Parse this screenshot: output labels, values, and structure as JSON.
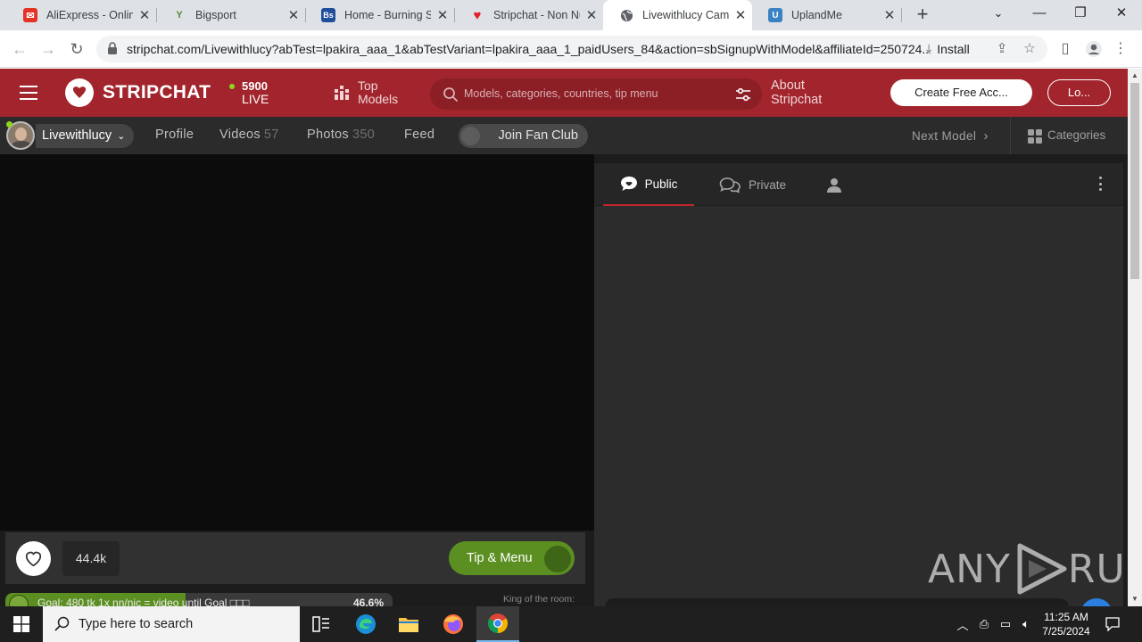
{
  "browser": {
    "tabs": [
      {
        "title": "AliExpress - Online",
        "icon": "aliexpress-icon",
        "color": "#e43225"
      },
      {
        "title": "Bigsport",
        "icon": "bigsport-icon",
        "color": "#5b8a3c"
      },
      {
        "title": "Home - Burning S",
        "icon": "bs-icon",
        "color": "#1f4e9a"
      },
      {
        "title": "Stripchat - Non Nu",
        "icon": "heart-icon",
        "color": "#e0202a"
      },
      {
        "title": "Livewithlucy Cam",
        "icon": "globe-icon",
        "color": "#5f6368"
      },
      {
        "title": "UplandMe",
        "icon": "uplandme-icon",
        "color": "#3b82c4"
      }
    ],
    "active_tab": 4,
    "url": "stripchat.com/Livewithlucy?abTest=lpakira_aaa_1&abTestVariant=lpakira_aaa_1_paidUsers_84&action=sbSignupWithModel&affiliateId=250724...",
    "install_label": "Install"
  },
  "header": {
    "brand": "STRIPCHAT",
    "live_count": "5900",
    "live_label": "LIVE",
    "top_models_line1": "Top",
    "top_models_line2": "Models",
    "search_placeholder": "Models, categories, countries, tip menu",
    "about_line1": "About",
    "about_line2": "Stripchat",
    "create_account": "Create Free Acc...",
    "login": "Lo..."
  },
  "model_nav": {
    "model_name": "Livewithlucy",
    "links": [
      {
        "label": "Profile",
        "count": ""
      },
      {
        "label": "Videos",
        "count": "57"
      },
      {
        "label": "Photos",
        "count": "350"
      },
      {
        "label": "Feed",
        "count": ""
      }
    ],
    "fan_club": "Join Fan Club",
    "next_model": "Next Model",
    "categories": "Categories"
  },
  "player": {
    "favorites_count": "44.4k",
    "tip_menu": "Tip & Menu",
    "goal_text": "Goal: 480 tk 1x nn/nic = video until Goal □□□",
    "goal_percent": "46.6%",
    "goal_progress": 0.466,
    "king_of_room": "King of the room:"
  },
  "chat": {
    "tabs": [
      {
        "label": "Public",
        "icon": "chat-bubble-icon"
      },
      {
        "label": "Private",
        "icon": "private-chat-icon"
      },
      {
        "label": "",
        "icon": "user-icon"
      }
    ]
  },
  "watermark": {
    "text_left": "ANY",
    "text_right": "RUN"
  },
  "taskbar": {
    "search_placeholder": "Type here to search",
    "time": "11:25 AM",
    "date": "7/25/2024"
  }
}
